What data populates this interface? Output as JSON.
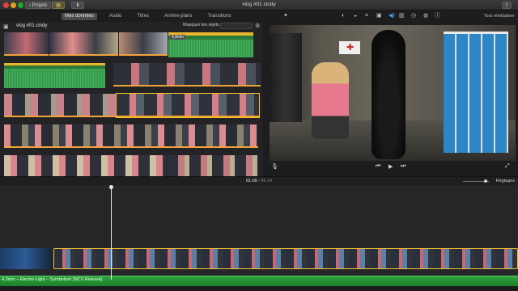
{
  "window": {
    "title": "vlog #01 cindy"
  },
  "toolbar": {
    "back_label": "‹ Projets",
    "media_label": "▤",
    "share_small": "⬇",
    "share_label": "⇪"
  },
  "tabs": [
    {
      "label": "Mes données",
      "active": true
    },
    {
      "label": "Audio",
      "active": false
    },
    {
      "label": "Titres",
      "active": false
    },
    {
      "label": "Arrière-plans",
      "active": false
    },
    {
      "label": "Transitions",
      "active": false
    }
  ],
  "viewer_tools": {
    "icons": [
      "magic-wand-icon",
      "color-balance-icon",
      "color-correction-icon",
      "crop-icon",
      "stabilization-icon",
      "volume-icon",
      "noise-reduction-icon",
      "speed-icon",
      "clip-filter-icon",
      "info-icon"
    ],
    "reset_all": "Tout réinitialiser"
  },
  "browser": {
    "event_title": "vlog #01 cindy",
    "filter_label": "Masquer les rejets ⌄",
    "search_placeholder": "",
    "audio_clip_label": "4,9min"
  },
  "viewer": {
    "controls": {
      "prev": "⏮",
      "play": "▶",
      "next": "⏭"
    }
  },
  "timebar": {
    "current": "01:09",
    "separator": "/",
    "duration": "06:14",
    "settings_label": "Réglages"
  },
  "timeline": {
    "audio_label": "4,3min – Electro-Light – Symbolism [NCS Release]"
  },
  "colors": {
    "accent": "#f4c12e",
    "audio_green": "#2aa23a",
    "selection_orange": "#f1a33a"
  }
}
